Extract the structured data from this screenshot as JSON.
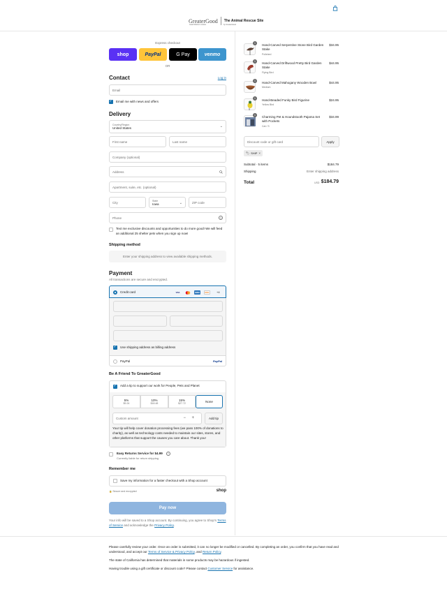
{
  "header": {
    "logo_brand": "GreaterGood",
    "logo_tagline": "Good Works In Action",
    "logo_partner": "The Animal Rescue Site",
    "logo_partner_sub": "by GreaterGood",
    "bag_icon": "shopping-bag-icon"
  },
  "express": {
    "label": "Express checkout",
    "shop": "shop",
    "paypal": "PayPal",
    "gpay": "G Pay",
    "venmo": "venmo",
    "or": "OR"
  },
  "contact": {
    "title": "Contact",
    "login": "Log in",
    "email_placeholder": "Email",
    "news_label": "Email me with news and offers"
  },
  "delivery": {
    "title": "Delivery",
    "country_label": "Country/Region",
    "country_value": "United States",
    "first_name": "First name",
    "last_name": "Last name",
    "company": "Company (optional)",
    "address": "Address",
    "apartment": "Apartment, suite, etc. (optional)",
    "city": "City",
    "state_label": "State",
    "state_value": "Iowa",
    "zip": "ZIP code",
    "phone": "Phone",
    "sms_label": "Text me exclusive discounts and opportunities to do more good! We will feed an additional 25 shelter pets when you sign up now!"
  },
  "shipping": {
    "title": "Shipping method",
    "info": "Enter your shipping address to view available shipping methods."
  },
  "payment": {
    "title": "Payment",
    "subtitle": "All transactions are secure and encrypted.",
    "credit_card": "Credit card",
    "card_logos": [
      "VISA",
      "MC",
      "AMEX",
      "DISC"
    ],
    "more_cards": "+4",
    "billing_label": "Use shipping address as billing address",
    "paypal": "PayPal",
    "paypal_logo": "PayPal"
  },
  "friend": {
    "title": "Be A Friend To GreaterGood",
    "tip_label": "Add a tip to support our work for People, Pets and Planet",
    "options": [
      {
        "pct": "5%",
        "amt": "$9.24"
      },
      {
        "pct": "10%",
        "amt": "$18.48"
      },
      {
        "pct": "15%",
        "amt": "$27.72"
      }
    ],
    "none": "None",
    "custom_placeholder": "Custom amount",
    "minus": "−",
    "plus": "+",
    "add_tip": "Add tip",
    "note": "Your tip will help cover donation processing fees (we pass 100% of donations to charity), as well as technology costs needed to maintain our sites, stores, and other platforms that support the causes you care about. Thank you!"
  },
  "returns": {
    "label": "Easy Returns Service for $4.99",
    "sub": "Currently liable for return shipping"
  },
  "remember": {
    "title": "Remember me",
    "label": "Save my information for a faster checkout with a Shop account",
    "secure": "Secure and encrypted",
    "shop": "shop"
  },
  "paynow": "Pay now",
  "legal": {
    "line1": "Your info will be saved to a Shop account. By continuing, you agree to Shop's",
    "tos": "Terms of Service",
    "mid": "and acknowledge the",
    "privacy": "Privacy Policy",
    "end": "."
  },
  "cart": {
    "items": [
      {
        "name": "Hand-Carved Serpentine Stone Bird Garden Stake",
        "variant": "Polished",
        "price": "$34.95",
        "qty": "1"
      },
      {
        "name": "Hand-Carved Driftwood Pretty Bird Garden Stake",
        "variant": "Flying Bird",
        "price": "$44.95",
        "qty": "1"
      },
      {
        "name": "Hand-Carved Mahogany Wooden Bowl",
        "variant": "Medium",
        "price": "$44.95",
        "qty": "1"
      },
      {
        "name": "Hand-Beaded Funky Bird Figurine",
        "variant": "Yellow Bird",
        "price": "$24.95",
        "qty": "1"
      },
      {
        "name": "Charming Pet & Houndstooth Pajama Set with Pockets",
        "variant": "Cat / S",
        "price": "$34.99",
        "qty": "1"
      }
    ],
    "discount_placeholder": "Discount code or gift card",
    "apply": "Apply",
    "tag": "SHIP",
    "subtotal_label": "Subtotal · 5 items",
    "subtotal_value": "$184.79",
    "shipping_label": "Shipping",
    "shipping_value": "Enter shipping address",
    "total_label": "Total",
    "currency": "USD",
    "total_value": "$184.79"
  },
  "footer": {
    "p1_a": "Please carefully review your order. Once an order is submitted, it can no longer be modified or cancelled. By completing an order, you confirm that you have read and understood, and accept our",
    "p1_link1": "Terms of Service & Privacy Policy",
    "p1_b": ", and",
    "p1_link2": "Return Policy",
    "p1_c": ".",
    "p2": "The state of California has determined that materials in some products may be hazardous if ingested.",
    "p3_a": "Having trouble using a gift certificate or discount code? Please contact",
    "p3_link": "Customer Service",
    "p3_b": "for assistance."
  }
}
